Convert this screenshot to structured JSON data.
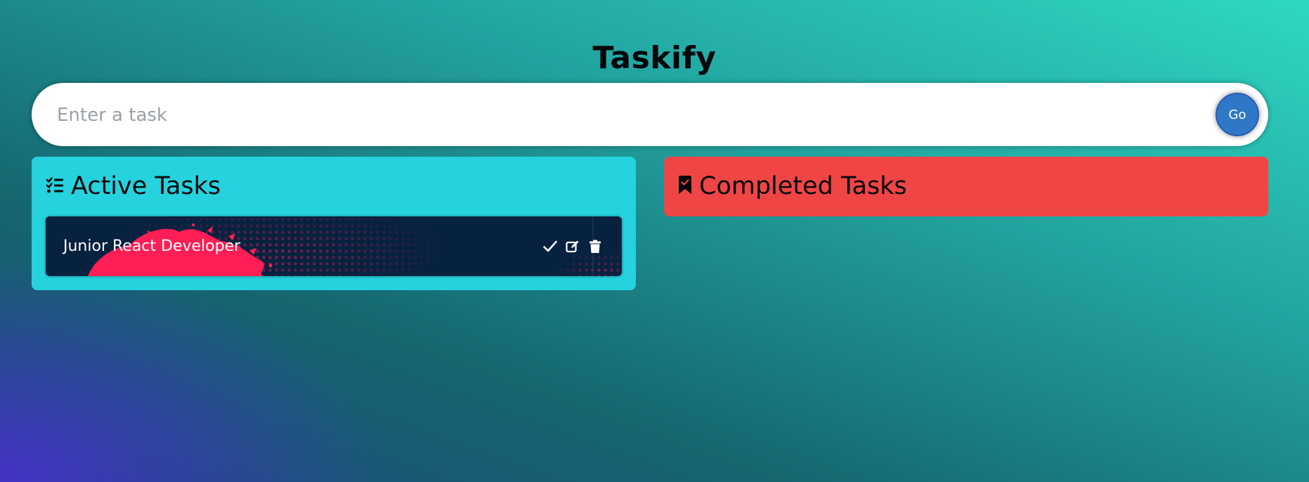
{
  "app": {
    "title": "Taskify"
  },
  "input": {
    "placeholder": "Enter a task",
    "value": ""
  },
  "submit": {
    "label": "Go"
  },
  "active_panel": {
    "heading": "Active Tasks",
    "icon": "list-check-icon",
    "color": "#25d2de",
    "tasks": [
      {
        "text": "Junior React Developer",
        "actions": [
          "check-icon",
          "edit-icon",
          "trash-icon"
        ]
      }
    ]
  },
  "completed_panel": {
    "heading": "Completed Tasks",
    "icon": "bookmark-check-icon",
    "color": "#f04545",
    "tasks": []
  }
}
